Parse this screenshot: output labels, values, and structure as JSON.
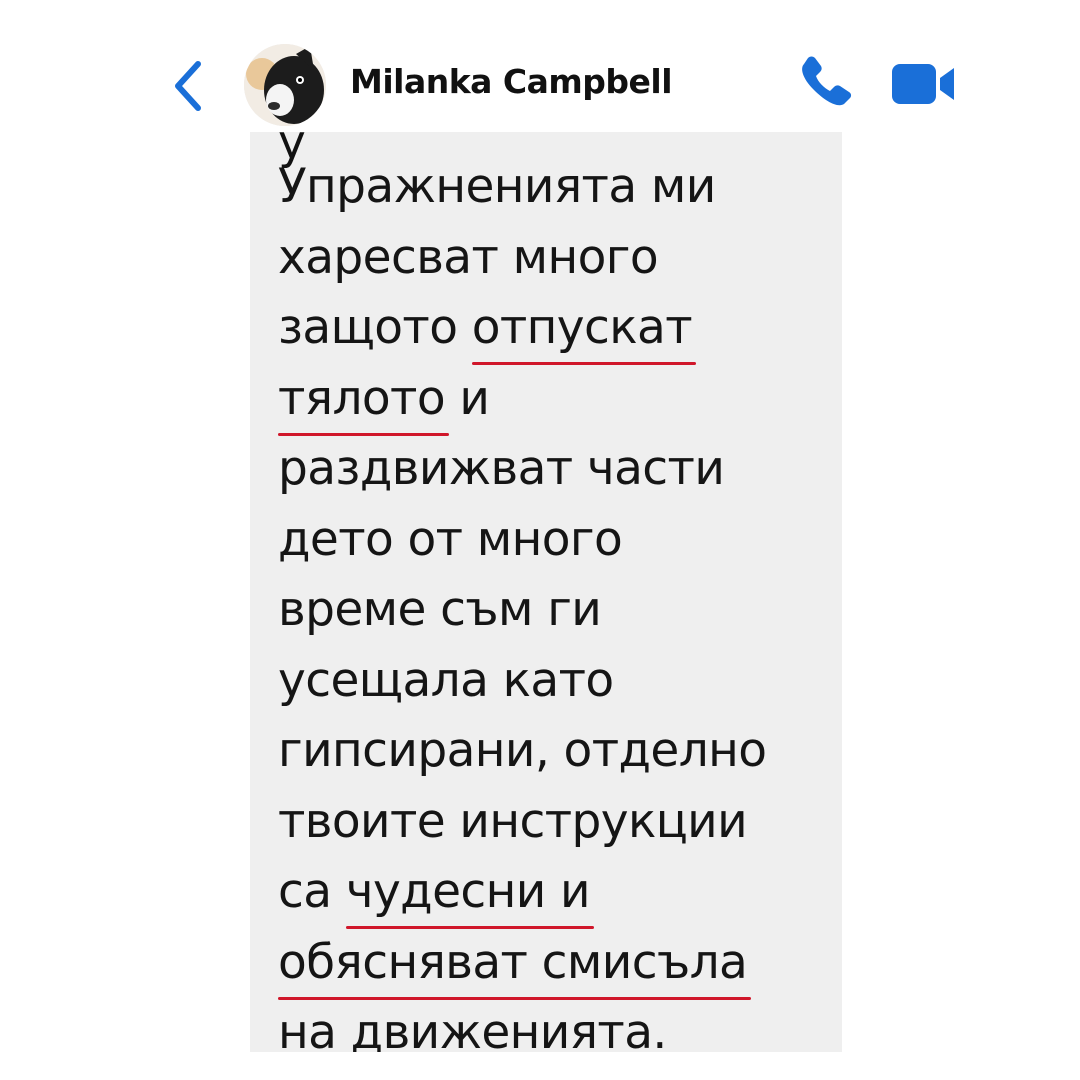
{
  "header": {
    "contact_name": "Milanka Campbell",
    "accent_color": "#1a6fd8",
    "icons": {
      "back": "chevron-left-icon",
      "call": "phone-icon",
      "video": "video-camera-icon"
    }
  },
  "message": {
    "bubble_color": "#efefef",
    "underline_color": "#d0162a",
    "cut_off_line": "у",
    "lines": [
      {
        "pre": "Упражненията ми",
        "u": "",
        "post": ""
      },
      {
        "pre": "харесват много",
        "u": "",
        "post": ""
      },
      {
        "pre": "защото ",
        "u": "отпускат",
        "post": ""
      },
      {
        "pre": "",
        "u": "тялото",
        "post": " и"
      },
      {
        "pre": "раздвижват части",
        "u": "",
        "post": ""
      },
      {
        "pre": "дето от много",
        "u": "",
        "post": ""
      },
      {
        "pre": "време съм ги",
        "u": "",
        "post": ""
      },
      {
        "pre": "усещала като",
        "u": "",
        "post": ""
      },
      {
        "pre": "гипсирани, отделно",
        "u": "",
        "post": ""
      },
      {
        "pre": "твоите инструкции",
        "u": "",
        "post": ""
      },
      {
        "pre": "са ",
        "u": "чудесни и",
        "post": ""
      },
      {
        "pre": "",
        "u": "обясняват смисъла",
        "post": ""
      },
      {
        "pre": "",
        "u": "на движенията",
        "post": "."
      }
    ]
  }
}
